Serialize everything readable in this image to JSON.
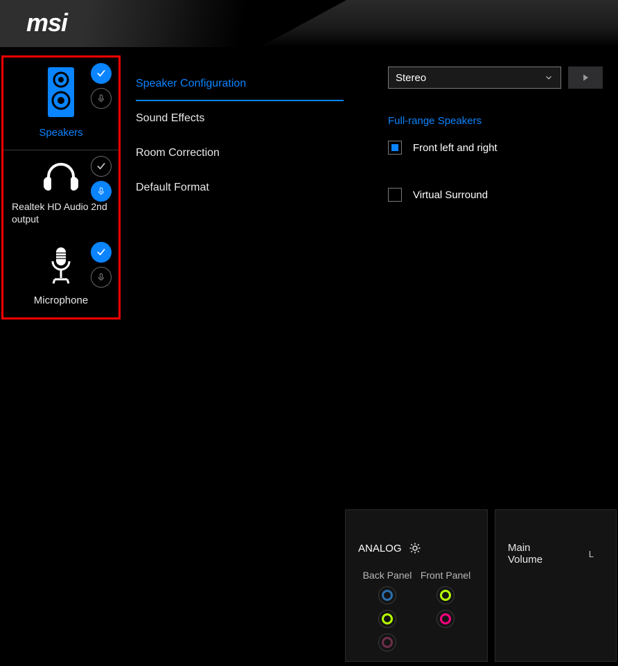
{
  "brand": "msi",
  "sidebar": {
    "devices": [
      {
        "label": "Speakers",
        "active": true,
        "check_badge": "blue",
        "mic_badge": "ring"
      },
      {
        "label": "Realtek HD Audio 2nd output",
        "active": false,
        "check_badge": "ring",
        "mic_badge": "blue"
      },
      {
        "label": "Microphone",
        "active": false,
        "check_badge": "blue",
        "mic_badge": "ring"
      }
    ]
  },
  "tabs": [
    {
      "label": "Speaker Configuration",
      "active": true
    },
    {
      "label": "Sound Effects",
      "active": false
    },
    {
      "label": "Room Correction",
      "active": false
    },
    {
      "label": "Default Format",
      "active": false
    }
  ],
  "config": {
    "select_value": "Stereo",
    "section_title": "Full-range Speakers",
    "options": [
      {
        "label": "Front left and right",
        "checked": true
      },
      {
        "label": "Virtual Surround",
        "checked": false
      }
    ]
  },
  "analog": {
    "title": "ANALOG",
    "col1": "Back Panel",
    "col2": "Front Panel",
    "jacks": {
      "back": [
        {
          "color": "#2a6fae"
        },
        {
          "color": "#b6ff00"
        },
        {
          "color": "#6e2f4a"
        }
      ],
      "front": [
        {
          "color": "#b6ff00"
        },
        {
          "color": "#ff007f"
        }
      ]
    }
  },
  "volume": {
    "title": "Main Volume",
    "channel": "L"
  }
}
